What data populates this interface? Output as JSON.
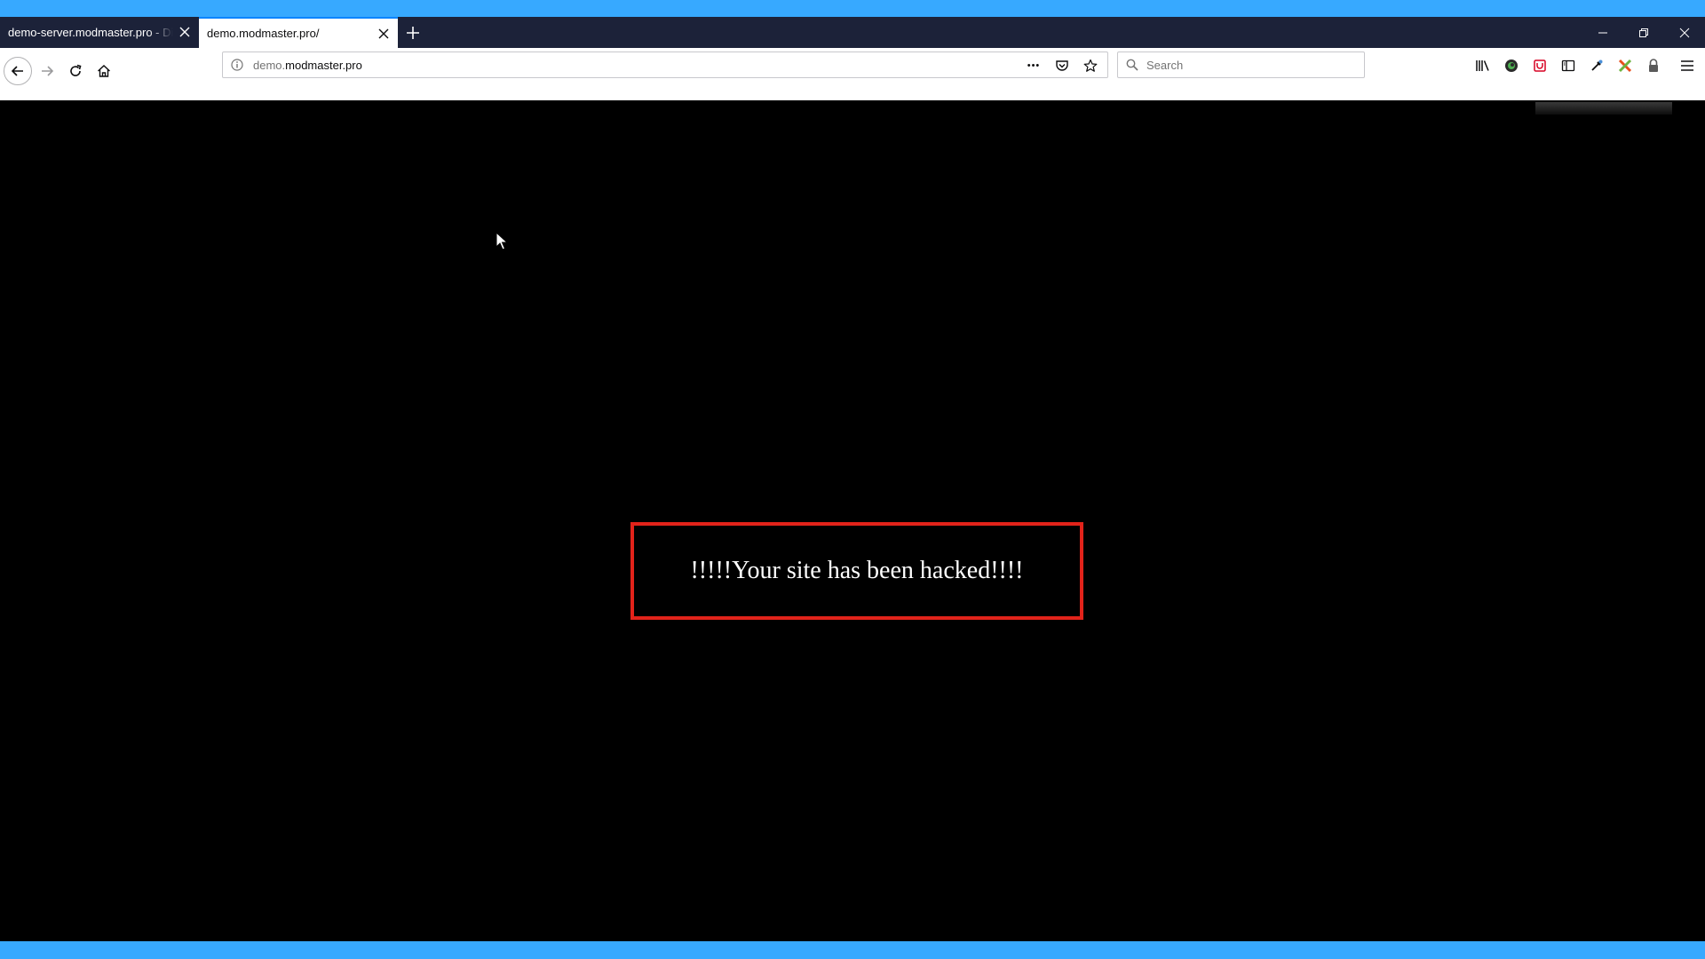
{
  "browser": {
    "tabs": [
      {
        "title": "demo-server.modmaster.pro - Directory",
        "active": false
      },
      {
        "title": "demo.modmaster.pro/",
        "active": true
      }
    ],
    "url_prefix": "demo.",
    "url_domain": "modmaster.pro",
    "search_placeholder": "Search",
    "overflow_glyph": "•••"
  },
  "icons": {
    "tab_close": "close-icon",
    "new_tab": "plus-icon",
    "back": "arrow-left-icon",
    "forward": "arrow-right-icon",
    "reload": "reload-icon",
    "home": "home-icon",
    "site_info": "info-icon",
    "pocket": "pocket-icon",
    "bookmark": "star-icon",
    "search": "magnifier-icon",
    "library": "library-icon",
    "menu": "hamburger-icon"
  },
  "page": {
    "message": "!!!!!Your site has been hacked!!!!"
  },
  "colors": {
    "accent_bar": "#37a9ff",
    "tabstrip": "#1c2239",
    "page_background": "#000000",
    "message_border": "#e2231a",
    "message_text": "#ffffff"
  }
}
